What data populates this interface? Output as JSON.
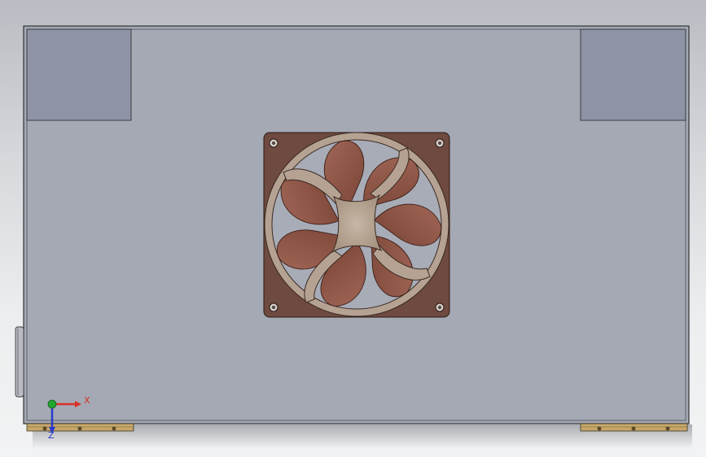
{
  "window": {
    "title": "",
    "background_top": "#b9bcc2",
    "background_bottom": "#f2f3f4"
  },
  "model": {
    "housing_color": "#a5a9b4",
    "housing_edge": "#2f3136",
    "corner_block_color": "#8e94a5",
    "foot_color": "#c7a86a",
    "fan_frame_color": "#6e4a40",
    "fan_ring_color": "#b5a292",
    "fan_blade_color": "#8e5648",
    "fan_hub_color": "#b5a292"
  },
  "triad": {
    "x_label": "X",
    "z_label": "Z",
    "x_color": "#d9302a",
    "y_color": "#21a52e",
    "z_color": "#2a39c9"
  }
}
